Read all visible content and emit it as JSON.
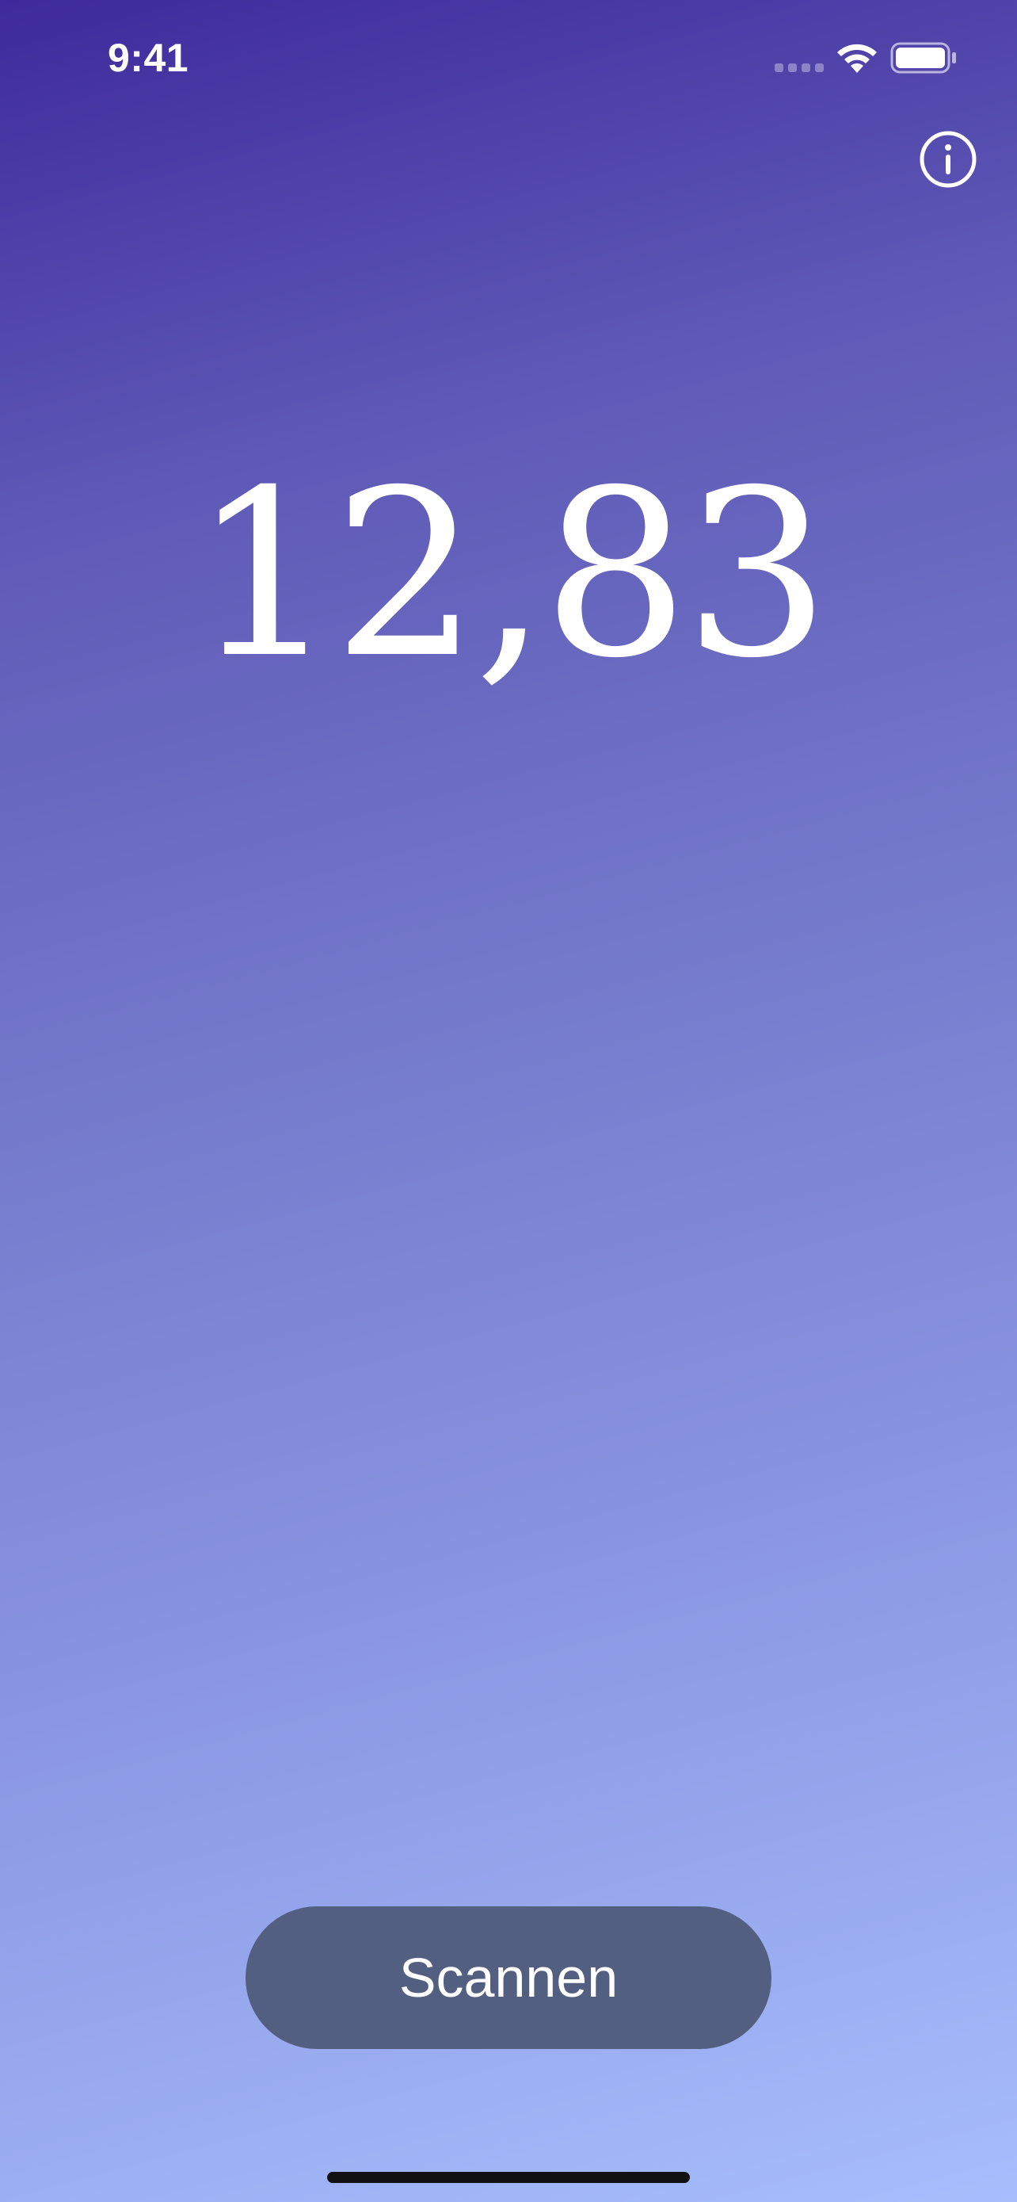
{
  "status_bar": {
    "time": "9:41",
    "signal_icon": "cellular-signal-icon",
    "wifi_icon": "wifi-icon",
    "battery_icon": "battery-icon",
    "battery_level": 1.0
  },
  "header": {
    "info_icon": "info-icon"
  },
  "main": {
    "value": "12,83"
  },
  "actions": {
    "scan_label": "Scannen"
  },
  "colors": {
    "gradient_top": "#3e2a9c",
    "gradient_bottom": "#a7bdfc",
    "button_background": "#535f80",
    "text": "#ffffff"
  }
}
